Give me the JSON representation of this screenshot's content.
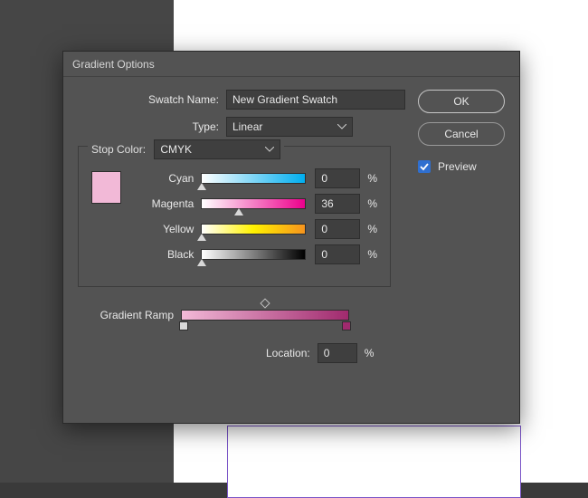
{
  "dialog": {
    "title": "Gradient Options",
    "swatch_name_label": "Swatch Name:",
    "swatch_name_value": "New Gradient Swatch",
    "type_label": "Type:",
    "type_value": "Linear",
    "stop_color_label": "Stop Color:",
    "stop_color_value": "CMYK",
    "swatch_color": "#f2b9d7",
    "channels": [
      {
        "label": "Cyan",
        "value": "0",
        "pos": 0
      },
      {
        "label": "Magenta",
        "value": "36",
        "pos": 36
      },
      {
        "label": "Yellow",
        "value": "0",
        "pos": 0
      },
      {
        "label": "Black",
        "value": "0",
        "pos": 0
      }
    ],
    "percent": "%",
    "gradient_ramp_label": "Gradient Ramp",
    "location_label": "Location:",
    "location_value": "0"
  },
  "buttons": {
    "ok": "OK",
    "cancel": "Cancel",
    "preview_label": "Preview",
    "preview_checked": true
  }
}
